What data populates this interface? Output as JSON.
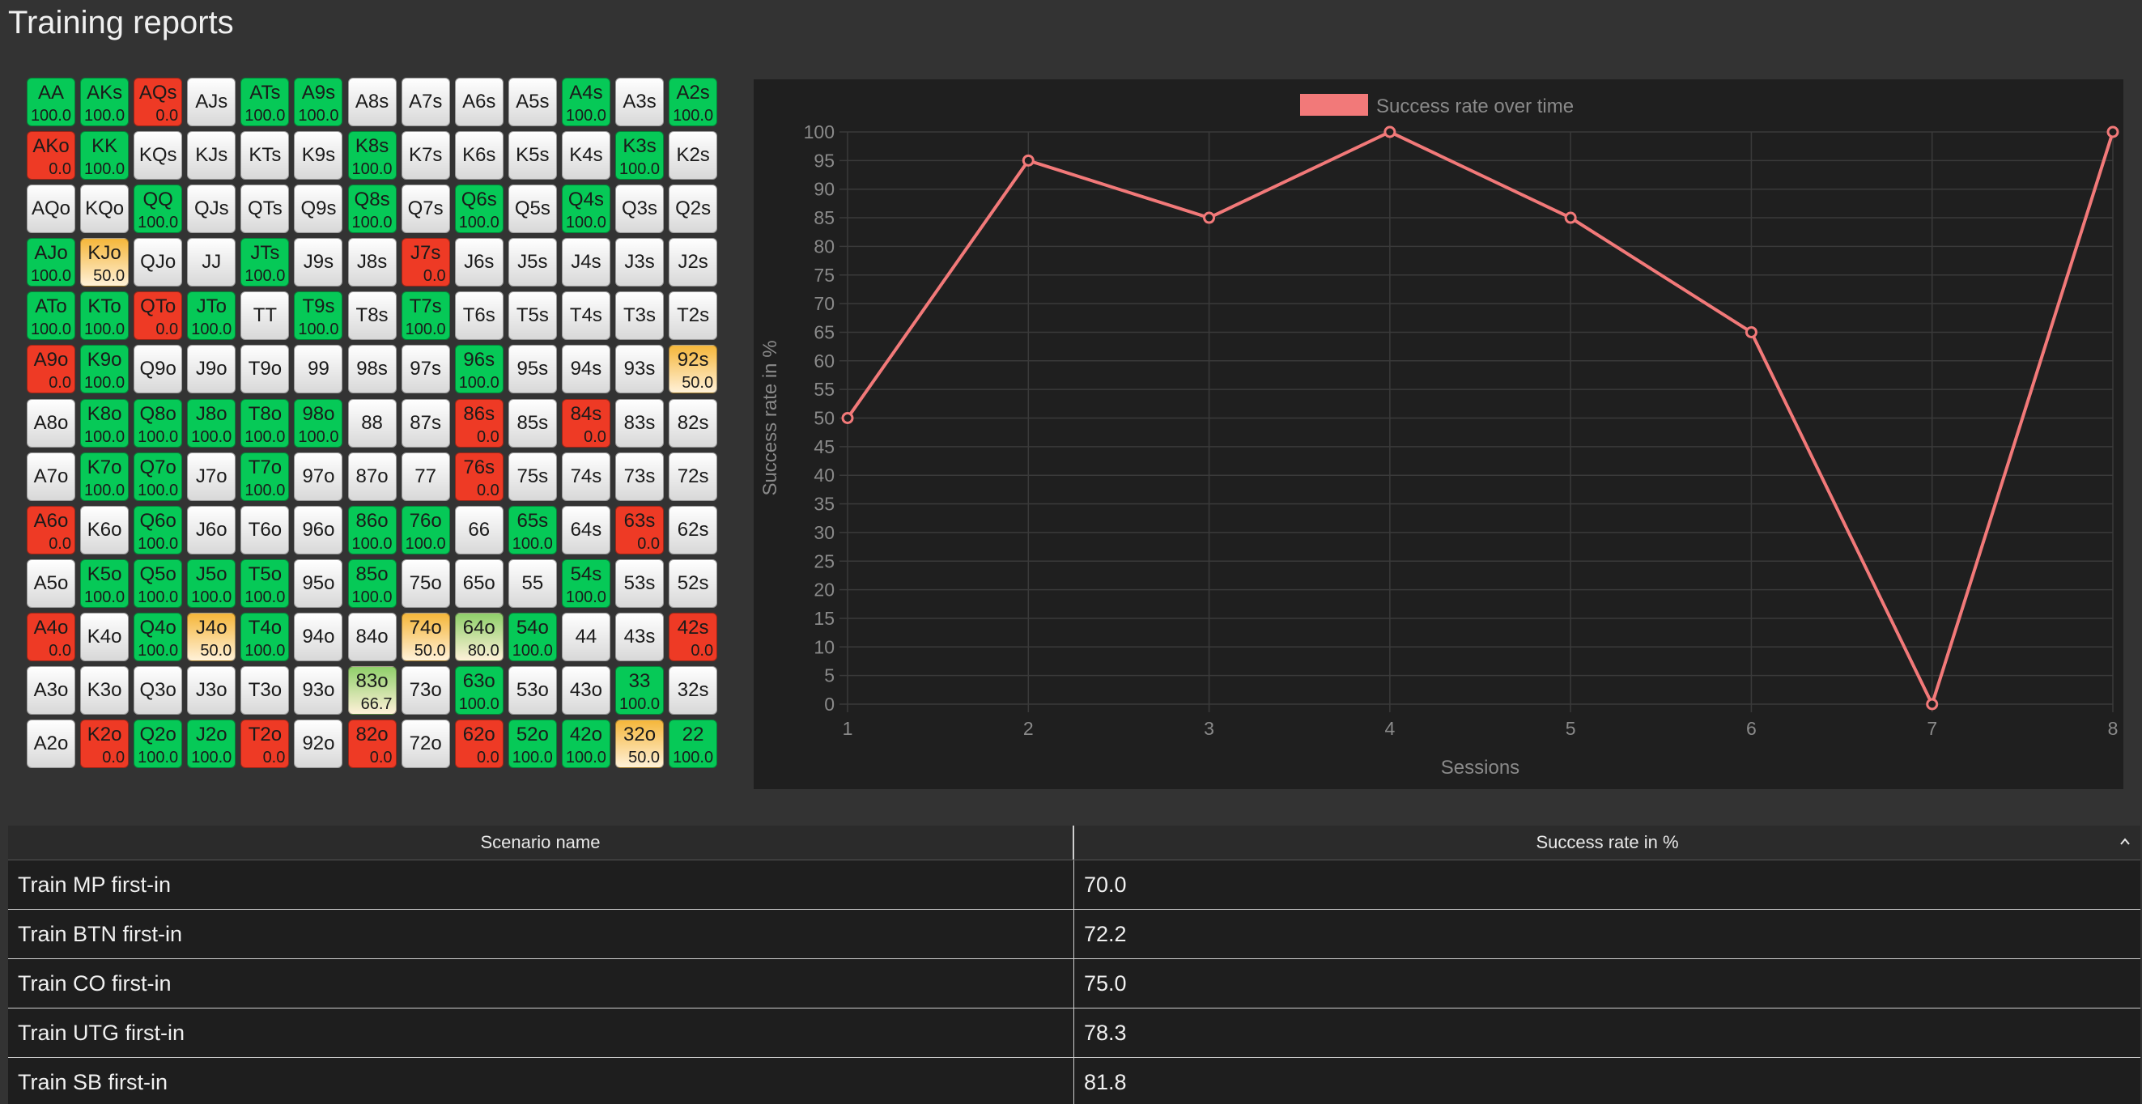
{
  "page": {
    "title": "Training reports"
  },
  "colors": {
    "green": "#06c957",
    "red": "#ee3a25",
    "orange": "#f5b63a",
    "light_green": "#8fcf6a",
    "chart_line": "#f27979",
    "chart_bg": "#1f1f1f",
    "grid_line": "#3a3a3a",
    "axis_text": "#8a8a8a"
  },
  "hand_grid": {
    "rows": [
      [
        {
          "hand": "AA",
          "rate": "100.0"
        },
        {
          "hand": "AKs",
          "rate": "100.0"
        },
        {
          "hand": "AQs",
          "rate": "0.0"
        },
        {
          "hand": "AJs",
          "rate": null
        },
        {
          "hand": "ATs",
          "rate": "100.0"
        },
        {
          "hand": "A9s",
          "rate": "100.0"
        },
        {
          "hand": "A8s",
          "rate": null
        },
        {
          "hand": "A7s",
          "rate": null
        },
        {
          "hand": "A6s",
          "rate": null
        },
        {
          "hand": "A5s",
          "rate": null
        },
        {
          "hand": "A4s",
          "rate": "100.0"
        },
        {
          "hand": "A3s",
          "rate": null
        },
        {
          "hand": "A2s",
          "rate": "100.0"
        }
      ],
      [
        {
          "hand": "AKo",
          "rate": "0.0"
        },
        {
          "hand": "KK",
          "rate": "100.0"
        },
        {
          "hand": "KQs",
          "rate": null
        },
        {
          "hand": "KJs",
          "rate": null
        },
        {
          "hand": "KTs",
          "rate": null
        },
        {
          "hand": "K9s",
          "rate": null
        },
        {
          "hand": "K8s",
          "rate": "100.0"
        },
        {
          "hand": "K7s",
          "rate": null
        },
        {
          "hand": "K6s",
          "rate": null
        },
        {
          "hand": "K5s",
          "rate": null
        },
        {
          "hand": "K4s",
          "rate": null
        },
        {
          "hand": "K3s",
          "rate": "100.0"
        },
        {
          "hand": "K2s",
          "rate": null
        }
      ],
      [
        {
          "hand": "AQo",
          "rate": null
        },
        {
          "hand": "KQo",
          "rate": null
        },
        {
          "hand": "QQ",
          "rate": "100.0"
        },
        {
          "hand": "QJs",
          "rate": null
        },
        {
          "hand": "QTs",
          "rate": null
        },
        {
          "hand": "Q9s",
          "rate": null
        },
        {
          "hand": "Q8s",
          "rate": "100.0"
        },
        {
          "hand": "Q7s",
          "rate": null
        },
        {
          "hand": "Q6s",
          "rate": "100.0"
        },
        {
          "hand": "Q5s",
          "rate": null
        },
        {
          "hand": "Q4s",
          "rate": "100.0"
        },
        {
          "hand": "Q3s",
          "rate": null
        },
        {
          "hand": "Q2s",
          "rate": null
        }
      ],
      [
        {
          "hand": "AJo",
          "rate": "100.0"
        },
        {
          "hand": "KJo",
          "rate": "50.0"
        },
        {
          "hand": "QJo",
          "rate": null
        },
        {
          "hand": "JJ",
          "rate": null
        },
        {
          "hand": "JTs",
          "rate": "100.0"
        },
        {
          "hand": "J9s",
          "rate": null
        },
        {
          "hand": "J8s",
          "rate": null
        },
        {
          "hand": "J7s",
          "rate": "0.0"
        },
        {
          "hand": "J6s",
          "rate": null
        },
        {
          "hand": "J5s",
          "rate": null
        },
        {
          "hand": "J4s",
          "rate": null
        },
        {
          "hand": "J3s",
          "rate": null
        },
        {
          "hand": "J2s",
          "rate": null
        }
      ],
      [
        {
          "hand": "ATo",
          "rate": "100.0"
        },
        {
          "hand": "KTo",
          "rate": "100.0"
        },
        {
          "hand": "QTo",
          "rate": "0.0"
        },
        {
          "hand": "JTo",
          "rate": "100.0"
        },
        {
          "hand": "TT",
          "rate": null
        },
        {
          "hand": "T9s",
          "rate": "100.0"
        },
        {
          "hand": "T8s",
          "rate": null
        },
        {
          "hand": "T7s",
          "rate": "100.0"
        },
        {
          "hand": "T6s",
          "rate": null
        },
        {
          "hand": "T5s",
          "rate": null
        },
        {
          "hand": "T4s",
          "rate": null
        },
        {
          "hand": "T3s",
          "rate": null
        },
        {
          "hand": "T2s",
          "rate": null
        }
      ],
      [
        {
          "hand": "A9o",
          "rate": "0.0"
        },
        {
          "hand": "K9o",
          "rate": "100.0"
        },
        {
          "hand": "Q9o",
          "rate": null
        },
        {
          "hand": "J9o",
          "rate": null
        },
        {
          "hand": "T9o",
          "rate": null
        },
        {
          "hand": "99",
          "rate": null
        },
        {
          "hand": "98s",
          "rate": null
        },
        {
          "hand": "97s",
          "rate": null
        },
        {
          "hand": "96s",
          "rate": "100.0"
        },
        {
          "hand": "95s",
          "rate": null
        },
        {
          "hand": "94s",
          "rate": null
        },
        {
          "hand": "93s",
          "rate": null
        },
        {
          "hand": "92s",
          "rate": "50.0"
        }
      ],
      [
        {
          "hand": "A8o",
          "rate": null
        },
        {
          "hand": "K8o",
          "rate": "100.0"
        },
        {
          "hand": "Q8o",
          "rate": "100.0"
        },
        {
          "hand": "J8o",
          "rate": "100.0"
        },
        {
          "hand": "T8o",
          "rate": "100.0"
        },
        {
          "hand": "98o",
          "rate": "100.0"
        },
        {
          "hand": "88",
          "rate": null
        },
        {
          "hand": "87s",
          "rate": null
        },
        {
          "hand": "86s",
          "rate": "0.0"
        },
        {
          "hand": "85s",
          "rate": null
        },
        {
          "hand": "84s",
          "rate": "0.0"
        },
        {
          "hand": "83s",
          "rate": null
        },
        {
          "hand": "82s",
          "rate": null
        }
      ],
      [
        {
          "hand": "A7o",
          "rate": null
        },
        {
          "hand": "K7o",
          "rate": "100.0"
        },
        {
          "hand": "Q7o",
          "rate": "100.0"
        },
        {
          "hand": "J7o",
          "rate": null
        },
        {
          "hand": "T7o",
          "rate": "100.0"
        },
        {
          "hand": "97o",
          "rate": null
        },
        {
          "hand": "87o",
          "rate": null
        },
        {
          "hand": "77",
          "rate": null
        },
        {
          "hand": "76s",
          "rate": "0.0"
        },
        {
          "hand": "75s",
          "rate": null
        },
        {
          "hand": "74s",
          "rate": null
        },
        {
          "hand": "73s",
          "rate": null
        },
        {
          "hand": "72s",
          "rate": null
        }
      ],
      [
        {
          "hand": "A6o",
          "rate": "0.0"
        },
        {
          "hand": "K6o",
          "rate": null
        },
        {
          "hand": "Q6o",
          "rate": "100.0"
        },
        {
          "hand": "J6o",
          "rate": null
        },
        {
          "hand": "T6o",
          "rate": null
        },
        {
          "hand": "96o",
          "rate": null
        },
        {
          "hand": "86o",
          "rate": "100.0"
        },
        {
          "hand": "76o",
          "rate": "100.0"
        },
        {
          "hand": "66",
          "rate": null
        },
        {
          "hand": "65s",
          "rate": "100.0"
        },
        {
          "hand": "64s",
          "rate": null
        },
        {
          "hand": "63s",
          "rate": "0.0"
        },
        {
          "hand": "62s",
          "rate": null
        }
      ],
      [
        {
          "hand": "A5o",
          "rate": null
        },
        {
          "hand": "K5o",
          "rate": "100.0"
        },
        {
          "hand": "Q5o",
          "rate": "100.0"
        },
        {
          "hand": "J5o",
          "rate": "100.0"
        },
        {
          "hand": "T5o",
          "rate": "100.0"
        },
        {
          "hand": "95o",
          "rate": null
        },
        {
          "hand": "85o",
          "rate": "100.0"
        },
        {
          "hand": "75o",
          "rate": null
        },
        {
          "hand": "65o",
          "rate": null
        },
        {
          "hand": "55",
          "rate": null
        },
        {
          "hand": "54s",
          "rate": "100.0"
        },
        {
          "hand": "53s",
          "rate": null
        },
        {
          "hand": "52s",
          "rate": null
        }
      ],
      [
        {
          "hand": "A4o",
          "rate": "0.0"
        },
        {
          "hand": "K4o",
          "rate": null
        },
        {
          "hand": "Q4o",
          "rate": "100.0"
        },
        {
          "hand": "J4o",
          "rate": "50.0"
        },
        {
          "hand": "T4o",
          "rate": "100.0"
        },
        {
          "hand": "94o",
          "rate": null
        },
        {
          "hand": "84o",
          "rate": null
        },
        {
          "hand": "74o",
          "rate": "50.0"
        },
        {
          "hand": "64o",
          "rate": "80.0"
        },
        {
          "hand": "54o",
          "rate": "100.0"
        },
        {
          "hand": "44",
          "rate": null
        },
        {
          "hand": "43s",
          "rate": null
        },
        {
          "hand": "42s",
          "rate": "0.0"
        }
      ],
      [
        {
          "hand": "A3o",
          "rate": null
        },
        {
          "hand": "K3o",
          "rate": null
        },
        {
          "hand": "Q3o",
          "rate": null
        },
        {
          "hand": "J3o",
          "rate": null
        },
        {
          "hand": "T3o",
          "rate": null
        },
        {
          "hand": "93o",
          "rate": null
        },
        {
          "hand": "83o",
          "rate": "66.7"
        },
        {
          "hand": "73o",
          "rate": null
        },
        {
          "hand": "63o",
          "rate": "100.0"
        },
        {
          "hand": "53o",
          "rate": null
        },
        {
          "hand": "43o",
          "rate": null
        },
        {
          "hand": "33",
          "rate": "100.0"
        },
        {
          "hand": "32s",
          "rate": null
        }
      ],
      [
        {
          "hand": "A2o",
          "rate": null
        },
        {
          "hand": "K2o",
          "rate": "0.0"
        },
        {
          "hand": "Q2o",
          "rate": "100.0"
        },
        {
          "hand": "J2o",
          "rate": "100.0"
        },
        {
          "hand": "T2o",
          "rate": "0.0"
        },
        {
          "hand": "92o",
          "rate": null
        },
        {
          "hand": "82o",
          "rate": "0.0"
        },
        {
          "hand": "72o",
          "rate": null
        },
        {
          "hand": "62o",
          "rate": "0.0"
        },
        {
          "hand": "52o",
          "rate": "100.0"
        },
        {
          "hand": "42o",
          "rate": "100.0"
        },
        {
          "hand": "32o",
          "rate": "50.0"
        },
        {
          "hand": "22",
          "rate": "100.0"
        }
      ]
    ]
  },
  "chart_data": {
    "type": "line",
    "title": "",
    "xlabel": "Sessions",
    "ylabel": "Success rate in %",
    "x": [
      1,
      2,
      3,
      4,
      5,
      6,
      7,
      8
    ],
    "series": [
      {
        "name": "Success rate over time",
        "values": [
          50,
          95,
          85,
          100,
          85,
          65,
          0,
          100
        ],
        "color": "#f27979"
      }
    ],
    "xlim": [
      1,
      8
    ],
    "ylim": [
      0,
      100
    ],
    "y_ticks": [
      0,
      5,
      10,
      15,
      20,
      25,
      30,
      35,
      40,
      45,
      50,
      55,
      60,
      65,
      70,
      75,
      80,
      85,
      90,
      95,
      100
    ],
    "x_ticks": [
      1,
      2,
      3,
      4,
      5,
      6,
      7,
      8
    ],
    "grid": true,
    "legend": "top-center"
  },
  "table": {
    "columns": [
      "Scenario name",
      "Success rate in %"
    ],
    "rows": [
      [
        "Train MP first-in",
        "70.0"
      ],
      [
        "Train BTN first-in",
        "72.2"
      ],
      [
        "Train CO first-in",
        "75.0"
      ],
      [
        "Train UTG first-in",
        "78.3"
      ],
      [
        "Train SB first-in",
        "81.8"
      ]
    ]
  }
}
